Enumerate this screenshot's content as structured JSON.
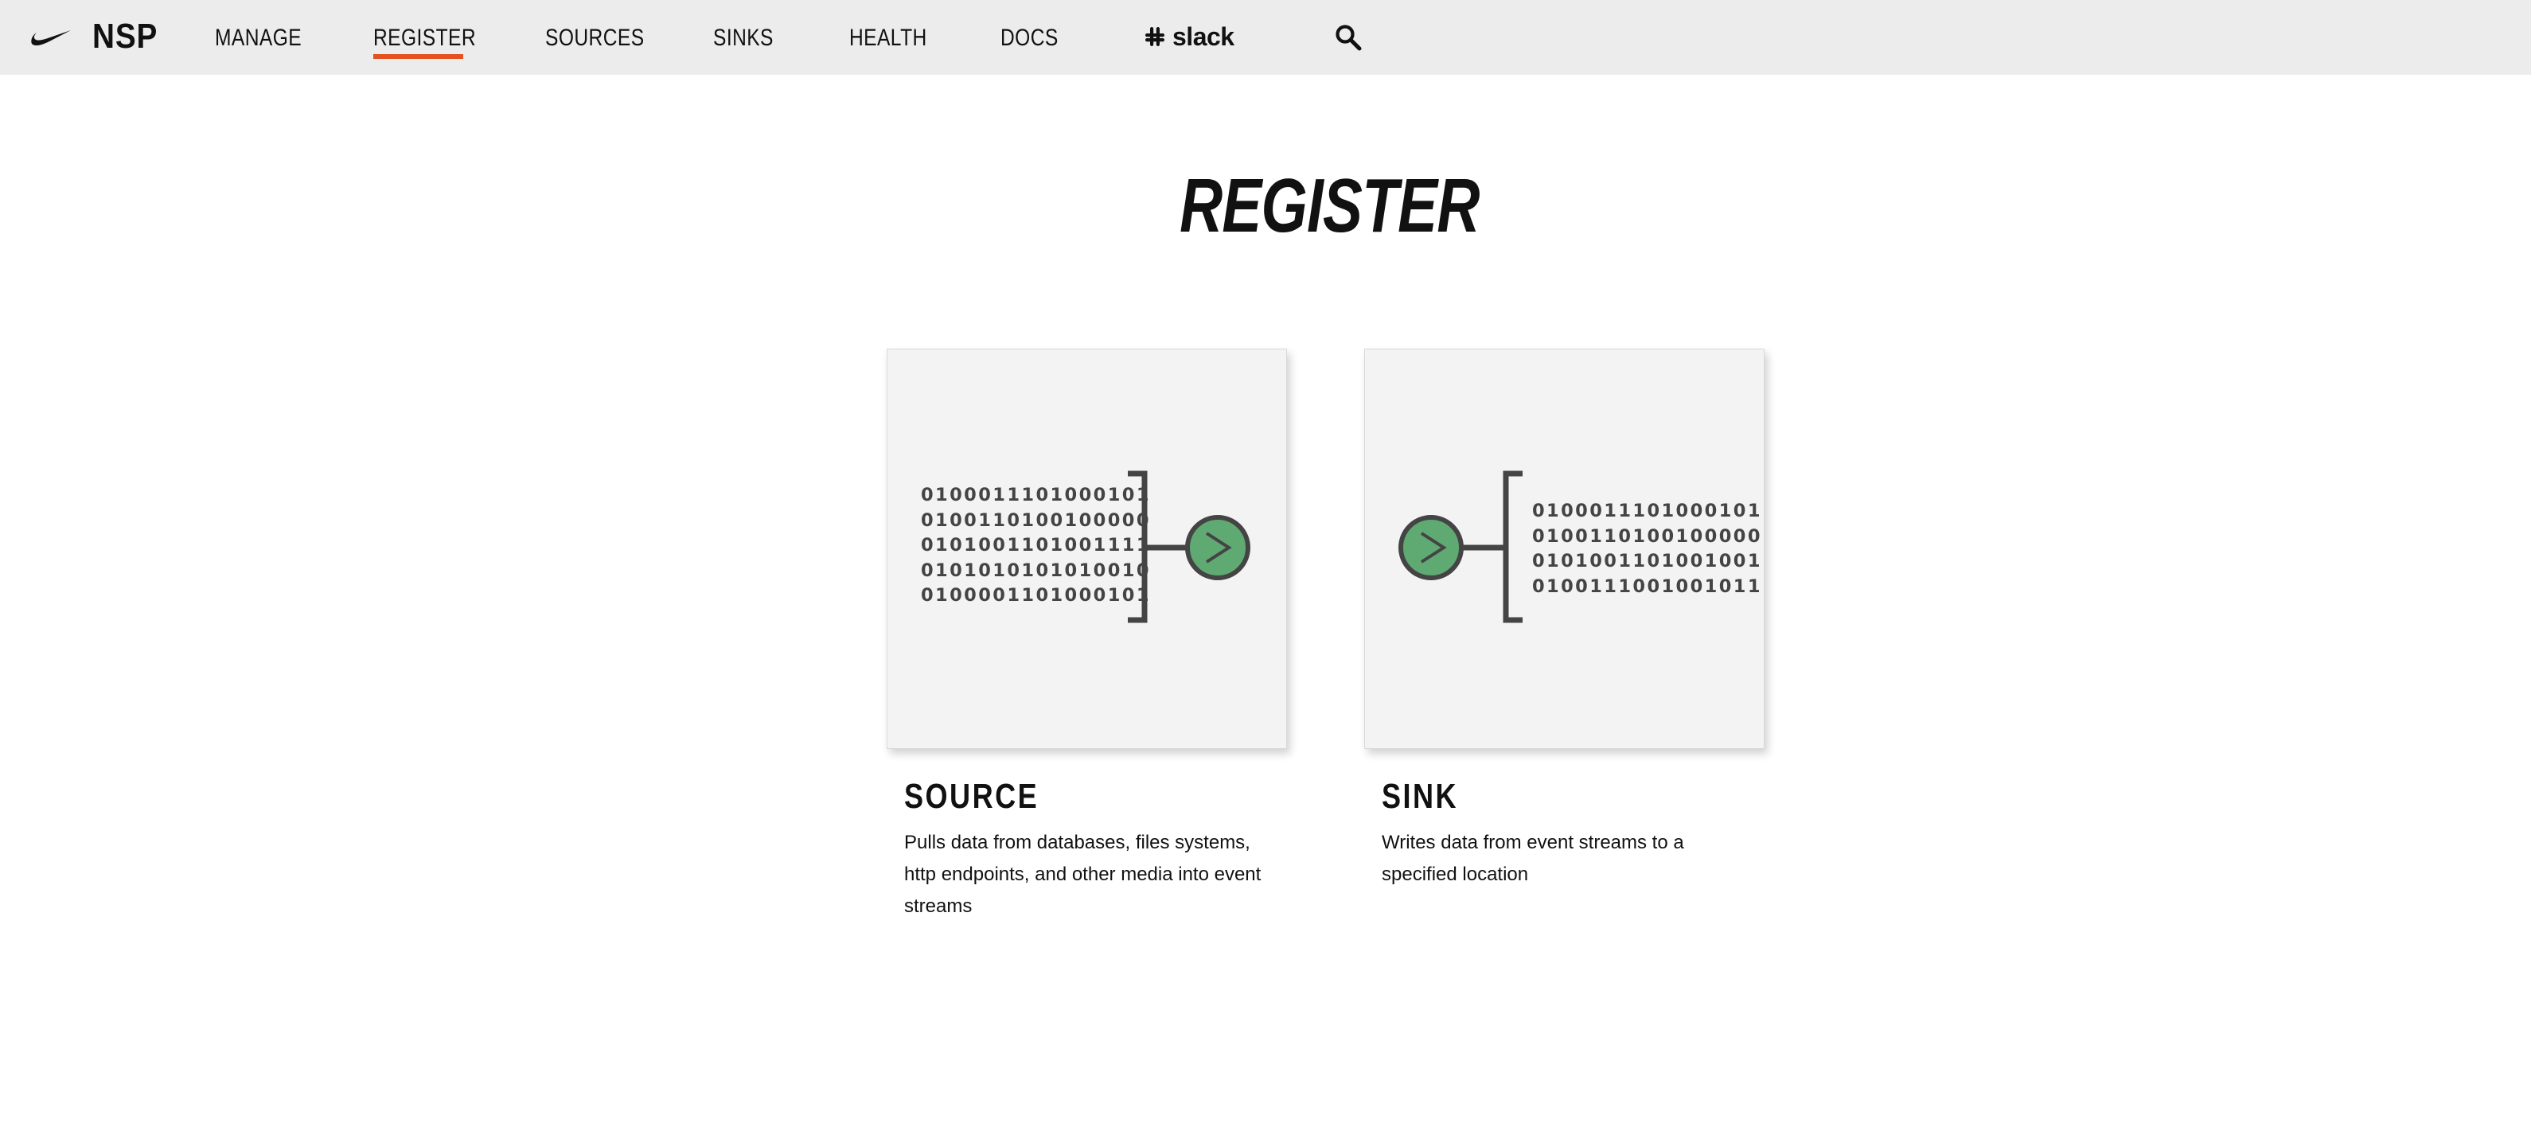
{
  "nav": {
    "brand": "NSP",
    "items": [
      {
        "label": "MANAGE"
      },
      {
        "label": "REGISTER",
        "active": true
      },
      {
        "label": "SOURCES"
      },
      {
        "label": "SINKS"
      },
      {
        "label": "HEALTH"
      },
      {
        "label": "DOCS"
      }
    ],
    "slack_label": "slack",
    "active_color": "#e2511f",
    "icons": {
      "logo": "nike-swoosh-icon",
      "slack": "slack-icon",
      "search": "search-icon"
    }
  },
  "main": {
    "title": "REGISTER"
  },
  "cards": {
    "source": {
      "title": "SOURCE",
      "description": "Pulls data from databases, files systems, http endpoints, and other media into event streams",
      "binary": "0100011101000101\n0100110100100000\n0101001101001111\n0101010101010010\n0100001101000101",
      "icon": "arrow-right-circle-icon",
      "accent_color": "#5faa72"
    },
    "sink": {
      "title": "SINK",
      "description": "Writes data from event streams to a specified location",
      "binary": "0100011101000101\n0100110100100000\n0101001101001001\n0100111001001011",
      "icon": "arrow-right-circle-icon",
      "accent_color": "#5faa72"
    }
  }
}
